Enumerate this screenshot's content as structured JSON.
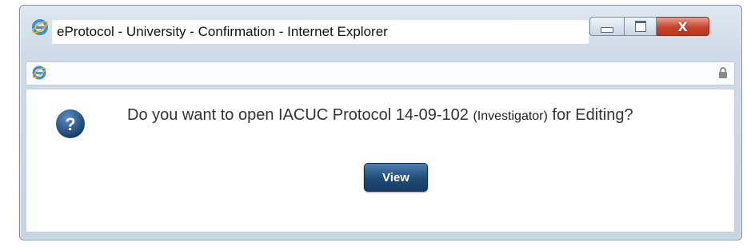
{
  "window": {
    "title": "eProtocol - University - Confirmation - Internet Explorer",
    "controls": {
      "minimize": "minimize",
      "maximize": "maximize",
      "close": "X"
    }
  },
  "address_bar": {
    "icons": [
      "ie-icon",
      "lock-icon"
    ]
  },
  "dialog": {
    "icon": "question-icon",
    "message_prefix": "Do you want to open IACUC Protocol 14-09-102 ",
    "role": "(Investigator)",
    "message_suffix": " for Editing?",
    "button_label": "View"
  },
  "colors": {
    "button": "#1e4a78",
    "close": "#c8452c",
    "question_icon": "#1f4f86"
  }
}
